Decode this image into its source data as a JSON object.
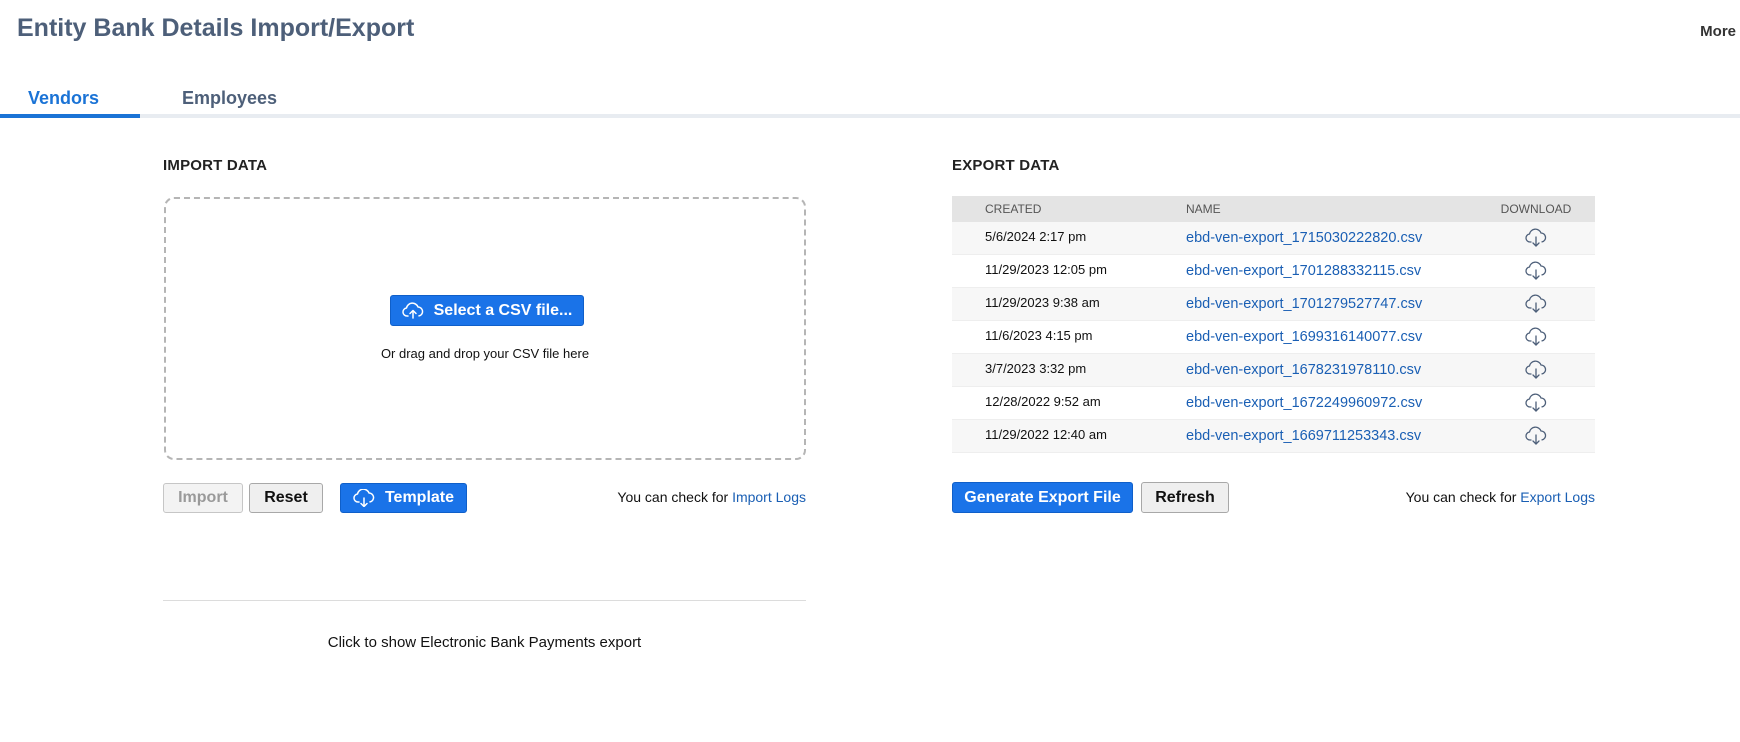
{
  "header": {
    "title": "Entity Bank Details Import/Export",
    "more_label": "More"
  },
  "tabs": [
    {
      "label": "Vendors",
      "active": true
    },
    {
      "label": "Employees",
      "active": false
    }
  ],
  "import": {
    "title": "IMPORT DATA",
    "select_label": "Select a CSV file...",
    "drop_hint": "Or drag and drop your CSV file here",
    "import_label": "Import",
    "reset_label": "Reset",
    "template_label": "Template",
    "logs_prefix": "You can check for",
    "logs_link": "Import Logs",
    "ebp_toggle": "Click to show Electronic Bank Payments export"
  },
  "export": {
    "title": "EXPORT DATA",
    "columns": {
      "created": "CREATED",
      "name": "NAME",
      "download": "DOWNLOAD"
    },
    "rows": [
      {
        "created": "5/6/2024 2:17 pm",
        "name": "ebd-ven-export_1715030222820.csv"
      },
      {
        "created": "11/29/2023 12:05 pm",
        "name": "ebd-ven-export_1701288332115.csv"
      },
      {
        "created": "11/29/2023 9:38 am",
        "name": "ebd-ven-export_1701279527747.csv"
      },
      {
        "created": "11/6/2023 4:15 pm",
        "name": "ebd-ven-export_1699316140077.csv"
      },
      {
        "created": "3/7/2023 3:32 pm",
        "name": "ebd-ven-export_1678231978110.csv"
      },
      {
        "created": "12/28/2022 9:52 am",
        "name": "ebd-ven-export_1672249960972.csv"
      },
      {
        "created": "11/29/2022 12:40 am",
        "name": "ebd-ven-export_1669711253343.csv"
      }
    ],
    "generate_label": "Generate Export File",
    "refresh_label": "Refresh",
    "logs_prefix": "You can check for",
    "logs_link": "Export Logs"
  },
  "colors": {
    "accent": "#1a73e8",
    "title": "#4d5f79",
    "link": "#1a5fb4"
  },
  "icons": {
    "upload": "cloud-upload-icon",
    "download": "cloud-download-icon"
  }
}
